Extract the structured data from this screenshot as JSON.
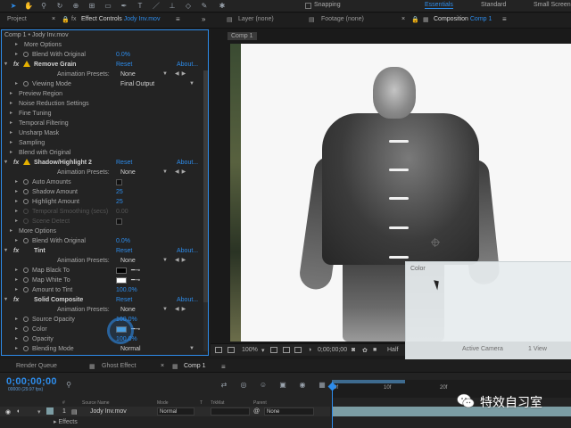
{
  "toolbar": {
    "snapping_label": "Snapping",
    "workspaces": [
      "Essentials",
      "Standard",
      "Small Screen"
    ],
    "active_workspace": "Essentials",
    "tools": [
      "selection-tool-icon",
      "hand-tool-icon",
      "zoom-tool-icon",
      "rotate-tool-icon",
      "camera-orbit-icon",
      "pan-behind-icon",
      "rectangle-tool-icon",
      "pen-tool-icon",
      "type-tool-icon",
      "brush-tool-icon",
      "clone-stamp-icon",
      "eraser-icon",
      "roto-brush-icon",
      "puppet-pin-icon"
    ]
  },
  "panels": {
    "project_tab": "Project",
    "effect_controls_tab": "Effect Controls",
    "effect_controls_target": "Jody Inv.mov",
    "layer_tab": "Layer (none)",
    "footage_tab": "Footage (none)",
    "composition_tab": "Composition",
    "composition_target": "Comp 1"
  },
  "effect_controls": {
    "header": "Comp 1 • Jody Inv.mov",
    "rows": [
      {
        "kind": "prop-group",
        "indent": 1,
        "label": "More Options"
      },
      {
        "kind": "prop",
        "indent": 1,
        "label": "Blend With Original",
        "value": "0.0%"
      },
      {
        "kind": "fx",
        "label": "Remove Grain",
        "warn": true,
        "reset": "Reset",
        "about": "About..."
      },
      {
        "kind": "preset",
        "label": "Animation Presets:",
        "value": "None"
      },
      {
        "kind": "prop",
        "indent": 1,
        "label": "Viewing Mode",
        "dropdown": "Final Output"
      },
      {
        "kind": "prop-group",
        "indent": 0,
        "label": "Preview Region"
      },
      {
        "kind": "prop-group",
        "indent": 0,
        "label": "Noise Reduction Settings"
      },
      {
        "kind": "prop-group",
        "indent": 0,
        "label": "Fine Tuning"
      },
      {
        "kind": "prop-group",
        "indent": 0,
        "label": "Temporal Filtering"
      },
      {
        "kind": "prop-group",
        "indent": 0,
        "label": "Unsharp Mask"
      },
      {
        "kind": "prop-group",
        "indent": 0,
        "label": "Sampling"
      },
      {
        "kind": "prop-group",
        "indent": 0,
        "label": "Blend with Original"
      },
      {
        "kind": "fx",
        "label": "Shadow/Highlight 2",
        "warn": true,
        "reset": "Reset",
        "about": "About..."
      },
      {
        "kind": "preset",
        "label": "Animation Presets:",
        "value": "None"
      },
      {
        "kind": "prop",
        "indent": 1,
        "label": "Auto Amounts",
        "checkbox": true
      },
      {
        "kind": "prop",
        "indent": 1,
        "label": "Shadow Amount",
        "value": "25"
      },
      {
        "kind": "prop",
        "indent": 1,
        "label": "Highlight Amount",
        "value": "25"
      },
      {
        "kind": "prop-dis",
        "indent": 1,
        "label": "Temporal Smoothing (secs)",
        "value": "0.00"
      },
      {
        "kind": "prop-dis",
        "indent": 1,
        "label": "Scene Detect",
        "checkbox": true
      },
      {
        "kind": "prop-group",
        "indent": 0,
        "label": "More Options"
      },
      {
        "kind": "prop",
        "indent": 1,
        "label": "Blend With Original",
        "value": "0.0%"
      },
      {
        "kind": "fx",
        "label": "Tint",
        "warn": false,
        "reset": "Reset",
        "about": "About..."
      },
      {
        "kind": "preset",
        "label": "Animation Presets:",
        "value": "None"
      },
      {
        "kind": "prop",
        "indent": 1,
        "label": "Map Black To",
        "swatch": "#000000"
      },
      {
        "kind": "prop",
        "indent": 1,
        "label": "Map White To",
        "swatch": "#ffffff"
      },
      {
        "kind": "prop",
        "indent": 1,
        "label": "Amount to Tint",
        "value": "100.0%"
      },
      {
        "kind": "fx",
        "label": "Solid Composite",
        "warn": false,
        "reset": "Reset",
        "about": "About..."
      },
      {
        "kind": "preset",
        "label": "Animation Presets:",
        "value": "None"
      },
      {
        "kind": "prop",
        "indent": 1,
        "label": "Source Opacity",
        "value": "100.0%"
      },
      {
        "kind": "prop",
        "indent": 1,
        "label": "Color",
        "swatch": "#4fa3e0"
      },
      {
        "kind": "prop",
        "indent": 1,
        "label": "Opacity",
        "value": "100.0%"
      },
      {
        "kind": "prop",
        "indent": 1,
        "label": "Blending Mode",
        "dropdown": "Normal"
      }
    ]
  },
  "composition": {
    "sub_tab": "Comp 1",
    "popup_title": "Color",
    "bar": {
      "zoom": "100%",
      "timecode": "0;00;00;00",
      "resolution": "Half",
      "camera": "Active Camera",
      "view": "1 View"
    }
  },
  "timeline": {
    "tabs": [
      "Render Queue",
      "Ghost Effect",
      "Comp 1"
    ],
    "active_tab": "Comp 1",
    "timecode": "0;00;00;00",
    "fps": "00000 (29.97 fps)",
    "col_headers": [
      "#",
      "Source Name",
      "Mode",
      "T",
      "TrkMat",
      "Parent"
    ],
    "layer": {
      "number": "1",
      "name": "Jody Inv.mov",
      "mode": "Normal",
      "parent": "None"
    },
    "effects_label": "Effects",
    "ruler_ticks": [
      "0f",
      "10f",
      "20f"
    ]
  },
  "watermark": {
    "text": "特效自习室"
  },
  "colors": {
    "accent": "#2d8ceb",
    "warning": "#e4b000",
    "panel": "#232323"
  }
}
